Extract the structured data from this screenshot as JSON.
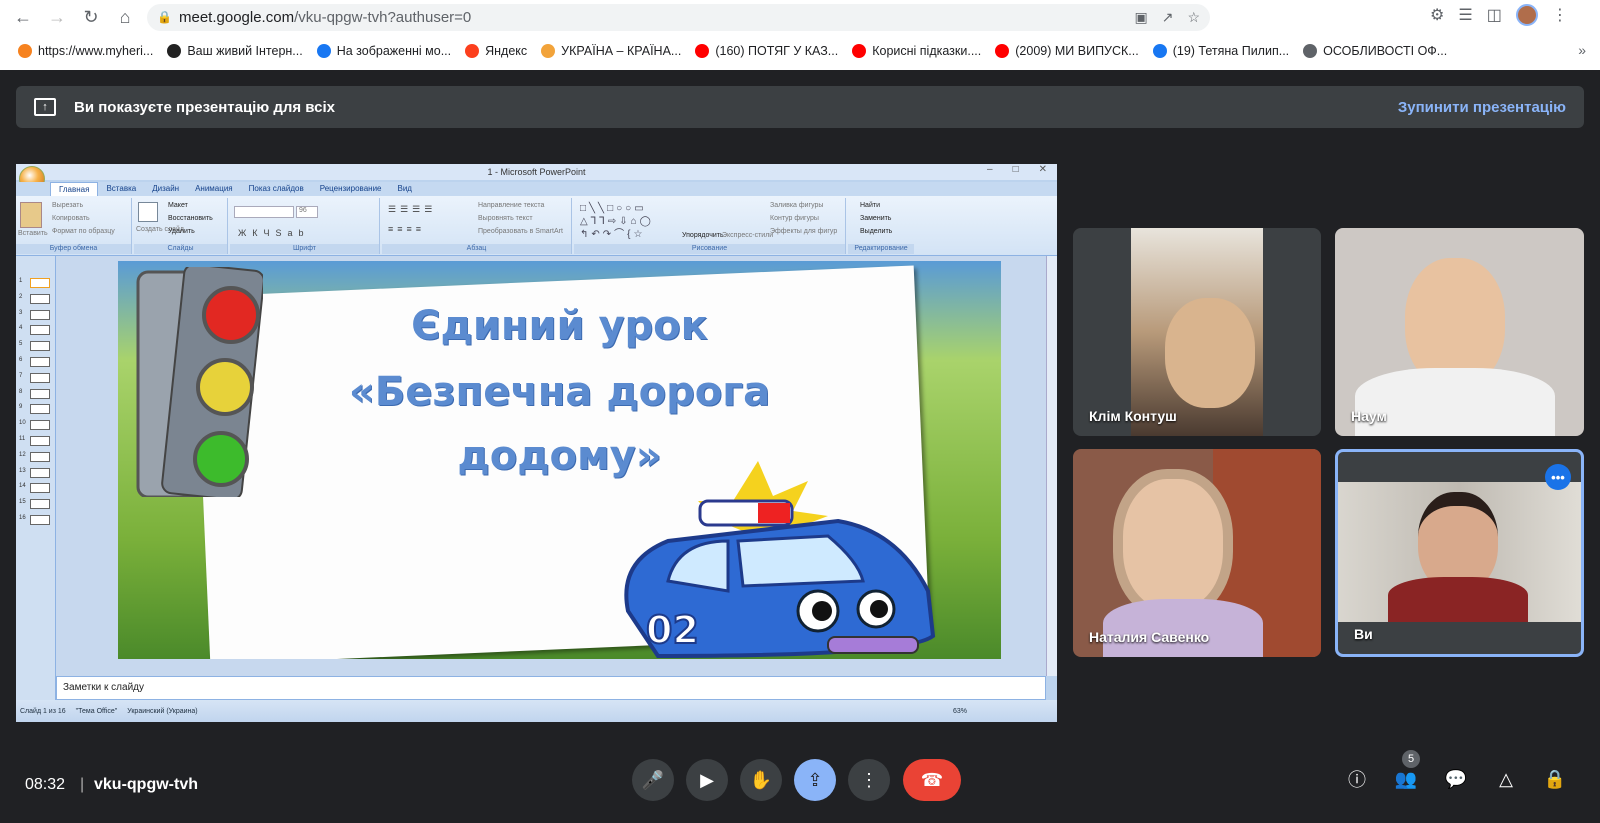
{
  "browser": {
    "url_host": "meet.google.com",
    "url_path": "/vku-qpgw-tvh?authuser=0",
    "bookmarks": [
      {
        "label": "https://www.myheri...",
        "color": "#f6821f"
      },
      {
        "label": "Ваш живий Інтерн...",
        "color": "#222222",
        "glyph": "24"
      },
      {
        "label": "На зображенні мо...",
        "color": "#1877f2"
      },
      {
        "label": "Яндекс",
        "color": "#fc3f1d"
      },
      {
        "label": "УКРАЇНА – КРАЇНА...",
        "color": "#f2a33a"
      },
      {
        "label": "(160) ПОТЯГ У КАЗ...",
        "color": "#ff0000"
      },
      {
        "label": "Корисні підказки....",
        "color": "#ff0000"
      },
      {
        "label": "(2009) МИ ВИПУСК...",
        "color": "#ff0000"
      },
      {
        "label": "(19) Тетяна Пилип...",
        "color": "#1877f2"
      },
      {
        "label": "ОСОБЛИВОСТІ ОФ...",
        "color": "#5f6368"
      }
    ],
    "bookmarks_more": "»"
  },
  "banner": {
    "text": "Ви показуєте презентацію для всіх",
    "stop_label": "Зупинити презентацію"
  },
  "powerpoint": {
    "window_title": "1 - Microsoft PowerPoint",
    "tabs": [
      "Главная",
      "Вставка",
      "Дизайн",
      "Анимация",
      "Показ слайдов",
      "Рецензирование",
      "Вид"
    ],
    "groups": {
      "clipboard": {
        "label": "Буфер обмена",
        "paste": "Вставить",
        "cut": "Вырезать",
        "copy": "Копировать",
        "format": "Формат по образцу"
      },
      "slides": {
        "label": "Слайды",
        "new": "Создать слайд",
        "layout": "Макет",
        "reset": "Восстановить",
        "delete": "Удалить"
      },
      "font": {
        "label": "Шрифт",
        "size": "96"
      },
      "paragraph": {
        "label": "Абзац",
        "dir": "Направление текста",
        "align": "Выровнять текст",
        "smartart": "Преобразовать в SmartArt"
      },
      "drawing": {
        "label": "Рисование",
        "arrange": "Упорядочить",
        "quick": "Экспресс-стили",
        "fill": "Заливка фигуры",
        "outline": "Контур фигуры",
        "effects": "Эффекты для фигур"
      },
      "editing": {
        "label": "Редактирование",
        "find": "Найти",
        "replace": "Заменить",
        "select": "Выделить"
      }
    },
    "slide_numbers": [
      "1",
      "2",
      "3",
      "4",
      "5",
      "6",
      "7",
      "8",
      "9",
      "10",
      "11",
      "12",
      "13",
      "14",
      "15",
      "16"
    ],
    "slide_title": [
      "Єдиний урок",
      "«Безпечна дорога",
      "додому»"
    ],
    "car_number": "02",
    "notes": "Заметки к слайду",
    "status": {
      "slide": "Слайд 1 из 16",
      "theme": "\"Тема Office\"",
      "lang": "Украинский (Украина)",
      "zoom": "63%"
    }
  },
  "participants": [
    {
      "name": "Клім Контуш",
      "bg": "#5b5550"
    },
    {
      "name": "Наум",
      "bg": "#c9c4c0"
    },
    {
      "name": "Наталия Савенко",
      "bg": "#8a5a48"
    },
    {
      "name": "Ви",
      "bg": "#6c6a66",
      "active": true
    }
  ],
  "bottom": {
    "time": "08:32",
    "separator": "|",
    "meeting_code": "vku-qpgw-tvh",
    "people_count": "5"
  }
}
